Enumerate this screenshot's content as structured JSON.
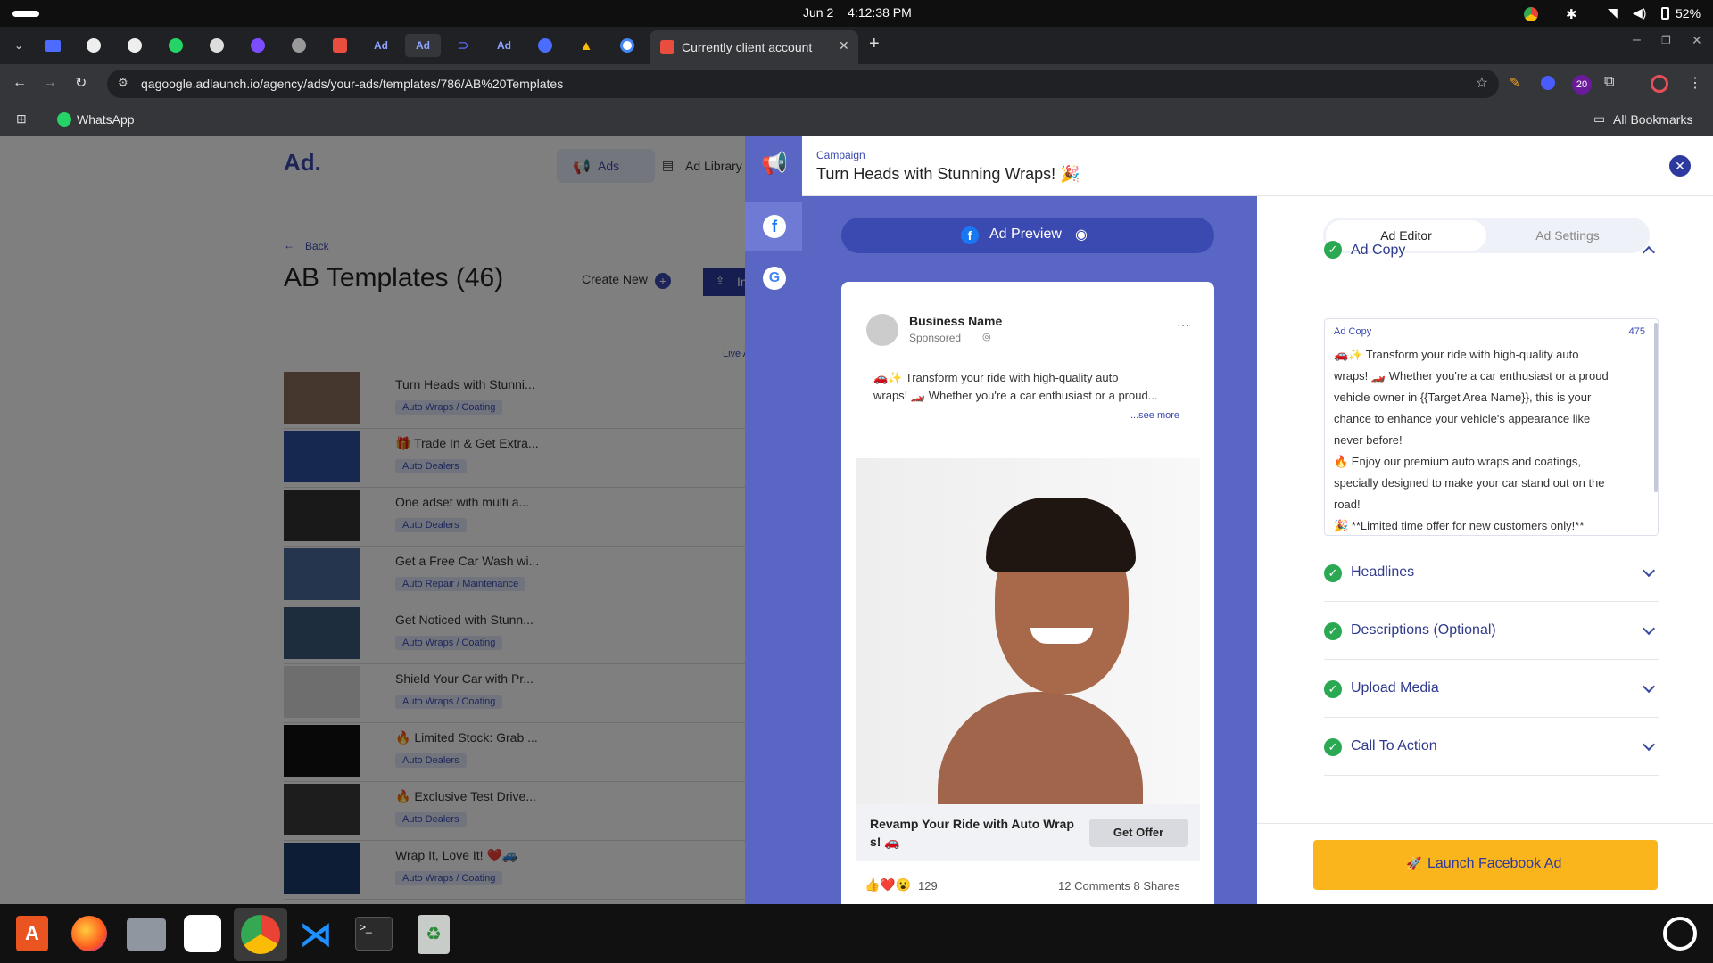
{
  "system": {
    "date": "Jun 2",
    "time": "4:12:38 PM",
    "battery": "52%"
  },
  "browser": {
    "active_tab_title": "Currently client account",
    "url": "qagoogle.adlaunch.io/agency/ads/your-ads/templates/786/AB%20Templates",
    "extension_badge": "20",
    "bookmark_whatsapp": "WhatsApp",
    "all_bookmarks": "All Bookmarks"
  },
  "app": {
    "logo": "Ad.",
    "nav": {
      "ads": "Ads",
      "ad_library": "Ad Library"
    },
    "back": "Back",
    "page_title": "AB Templates (46)",
    "create_new": "Create New",
    "import": "Import",
    "live_ads": "Live Ads",
    "templates": [
      {
        "title": "Turn Heads with Stunni...",
        "tag": "Auto Wraps / Coating"
      },
      {
        "title": "🎁 Trade In & Get Extra...",
        "tag": "Auto Dealers"
      },
      {
        "title": "One adset with multi a...",
        "tag": "Auto Dealers"
      },
      {
        "title": "Get a Free Car Wash wi...",
        "tag": "Auto Repair / Maintenance"
      },
      {
        "title": "Get Noticed with Stunn...",
        "tag": "Auto Wraps / Coating"
      },
      {
        "title": "Shield Your Car with Pr...",
        "tag": "Auto Wraps / Coating"
      },
      {
        "title": "🔥 Limited Stock: Grab ...",
        "tag": "Auto Dealers"
      },
      {
        "title": "🔥 Exclusive Test Drive...",
        "tag": "Auto Dealers"
      },
      {
        "title": "Wrap It, Love It! ❤️🚙",
        "tag": "Auto Wraps / Coating"
      }
    ]
  },
  "panel": {
    "campaign_label": "Campaign",
    "campaign_title": "Turn Heads with Stunning Wraps! 🎉",
    "ad_preview": "Ad Preview",
    "fb_post": {
      "business_name": "Business Name",
      "sponsored": "Sponsored",
      "text_line1": "🚗✨ Transform your ride with high-quality auto",
      "text_line2": "wraps! 🏎️ Whether you're a car enthusiast or a proud...",
      "see_more": "...see more",
      "headline_line1": "Revamp Your Ride with Auto Wrap",
      "headline_line2": "s! 🚗",
      "cta": "Get Offer",
      "reactions_count": "129",
      "comments_shares": "12 Comments 8 Shares"
    },
    "editor_tab": "Ad Editor",
    "settings_tab": "Ad Settings",
    "ad_copy_section": "Ad Copy",
    "ad_copy_label": "Ad Copy",
    "ad_copy_count": "475",
    "ad_copy_text": [
      "🚗✨ Transform your ride with high-quality auto",
      "wraps! 🏎️ Whether you're a car enthusiast or a proud",
      "vehicle owner in {{Target Area Name}}, this is your",
      "chance to enhance your vehicle's appearance like",
      "never before!",
      "🔥 Enjoy our premium auto wraps and coatings,",
      "specially designed to make your car stand out on the",
      "road!",
      "🎉 **Limited time offer for new customers only!**"
    ],
    "sections": [
      "Headlines",
      "Descriptions (Optional)",
      "Upload Media",
      "Call To Action"
    ],
    "launch_button": "Launch Facebook Ad"
  },
  "colors": {
    "accent": "#3b4ab0",
    "panel_blue": "#5a66c4",
    "launch": "#f9b51b",
    "check": "#2aa952"
  }
}
